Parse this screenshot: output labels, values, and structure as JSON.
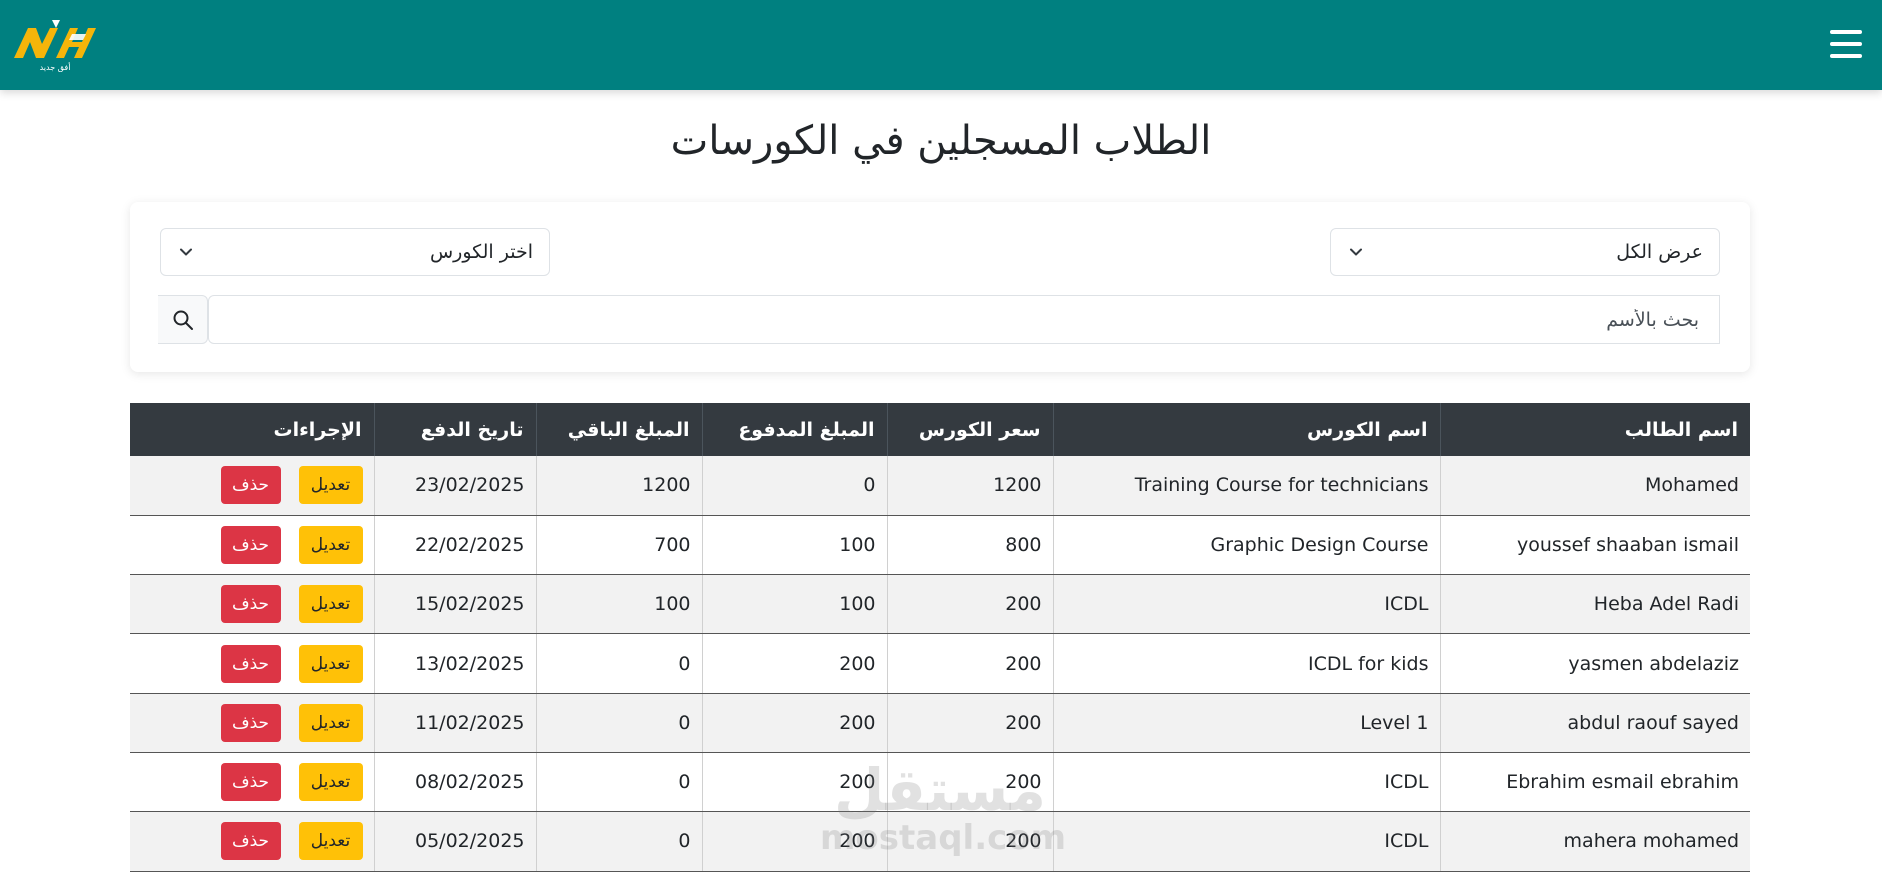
{
  "brand": {
    "logo_text": "أفق جديد",
    "colors": {
      "navbar": "#008080",
      "logo_yellow": "#f5b50a",
      "edit": "#ffc107",
      "delete": "#dc3545",
      "table_head": "#343a40"
    }
  },
  "header": {
    "menu_icon": "hamburger-icon"
  },
  "page": {
    "title": "الطلاب المسجلين في الكورسات"
  },
  "filters": {
    "status_select": "عرض الكل",
    "course_select": "اختر الكورس",
    "search_placeholder": "بحث بالأسم",
    "search_icon": "search-icon"
  },
  "table": {
    "columns": {
      "student": "اسم الطالب",
      "course": "اسم الكورس",
      "price": "سعر الكورس",
      "paid": "المبلغ المدفوع",
      "remaining": "المبلغ الباقي",
      "date": "تاريخ الدفع",
      "actions": "الإجراءات"
    },
    "edit_label": "تعديل",
    "delete_label": "حذف",
    "rows": [
      {
        "student": "Mohamed",
        "course": "Training Course for technicians",
        "price": "1200",
        "paid": "0",
        "remaining": "1200",
        "date": "23/02/2025"
      },
      {
        "student": "youssef shaaban ismail",
        "course": "Graphic Design Course",
        "price": "800",
        "paid": "100",
        "remaining": "700",
        "date": "22/02/2025"
      },
      {
        "student": "Heba Adel Radi",
        "course": "ICDL",
        "price": "200",
        "paid": "100",
        "remaining": "100",
        "date": "15/02/2025"
      },
      {
        "student": "yasmen abdelaziz",
        "course": "ICDL for kids",
        "price": "200",
        "paid": "200",
        "remaining": "0",
        "date": "13/02/2025"
      },
      {
        "student": "abdul raouf sayed",
        "course": "Level 1",
        "price": "200",
        "paid": "200",
        "remaining": "0",
        "date": "11/02/2025"
      },
      {
        "student": "Ebrahim esmail ebrahim",
        "course": "ICDL",
        "price": "200",
        "paid": "200",
        "remaining": "0",
        "date": "08/02/2025"
      },
      {
        "student": "mahera mohamed",
        "course": "ICDL",
        "price": "200",
        "paid": "200",
        "remaining": "0",
        "date": "05/02/2025"
      }
    ]
  },
  "watermark": {
    "arabic": "مستقل",
    "latin": "mostaql.com"
  }
}
